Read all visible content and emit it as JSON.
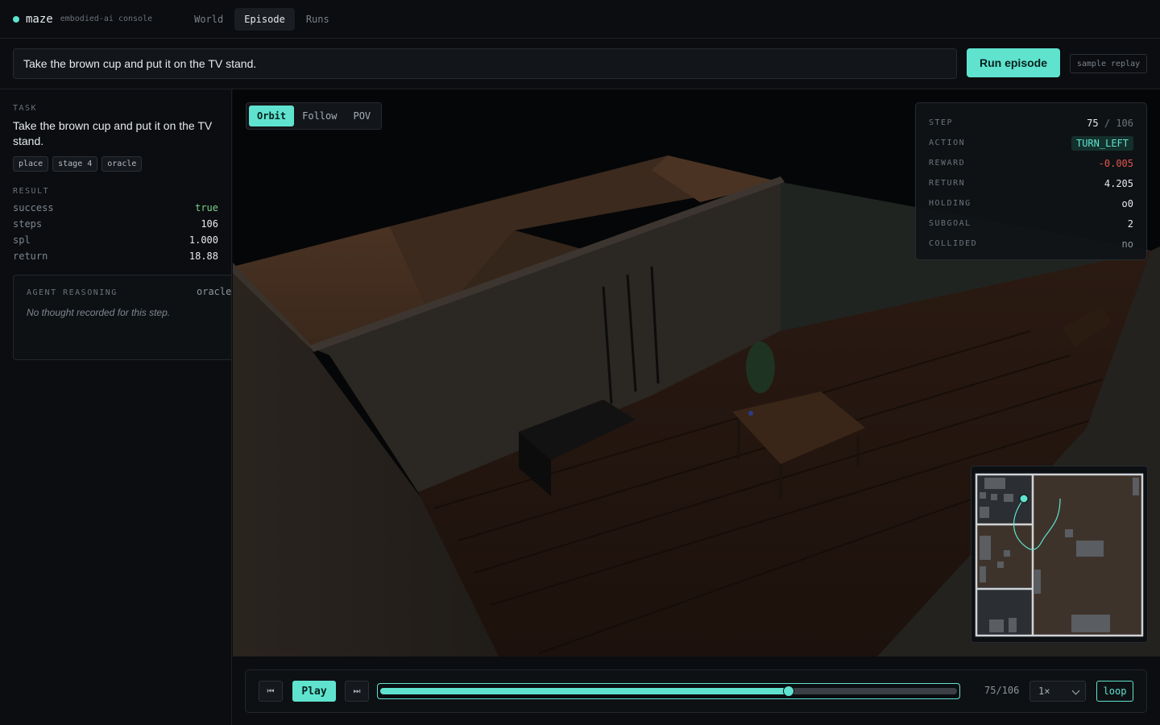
{
  "app": {
    "name": "maze",
    "subtitle": "embodied-ai console"
  },
  "nav": {
    "tabs": [
      {
        "label": "World"
      },
      {
        "label": "Episode"
      },
      {
        "label": "Runs"
      }
    ],
    "active": "Episode"
  },
  "taskbar": {
    "instruction": "Take the brown cup and put it on the TV stand.",
    "run_label": "Run episode",
    "sample_label": "sample replay"
  },
  "sidebar": {
    "task_label": "TASK",
    "task_text": "Take the brown cup and put it on the TV stand.",
    "tags": [
      "place",
      "stage 4",
      "oracle"
    ],
    "result_label": "RESULT",
    "result": [
      {
        "key": "success",
        "value": "true"
      },
      {
        "key": "steps",
        "value": "106"
      },
      {
        "key": "spl",
        "value": "1.000"
      },
      {
        "key": "return",
        "value": "18.88"
      }
    ],
    "reasoning": {
      "label": "AGENT REASONING",
      "mode": "oracle",
      "text": "No thought recorded for this step."
    }
  },
  "viewport": {
    "camera_modes": [
      "Orbit",
      "Follow",
      "POV"
    ],
    "active_mode": "Orbit"
  },
  "hud": {
    "step_label": "STEP",
    "step": "75",
    "step_sep": "/",
    "step_total": "106",
    "action_label": "ACTION",
    "action": "TURN_LEFT",
    "reward_label": "REWARD",
    "reward": "-0.005",
    "return_label": "RETURN",
    "return": "4.205",
    "holding_label": "HOLDING",
    "holding": "o0",
    "subgoal_label": "SUBGOAL",
    "subgoal": "2",
    "collided_label": "COLLIDED",
    "collided": "no"
  },
  "colors": {
    "accent": "#5fe3cf",
    "negative": "#e0574f",
    "success": "#79d28a",
    "floor_minimap": "#3e332b"
  },
  "playback": {
    "play_label": "Play",
    "first_icon": "skip-back-icon",
    "last_icon": "skip-forward-icon",
    "progress": 0.7075,
    "counter": "75/106",
    "speed": "1×",
    "loop_label": "loop"
  }
}
